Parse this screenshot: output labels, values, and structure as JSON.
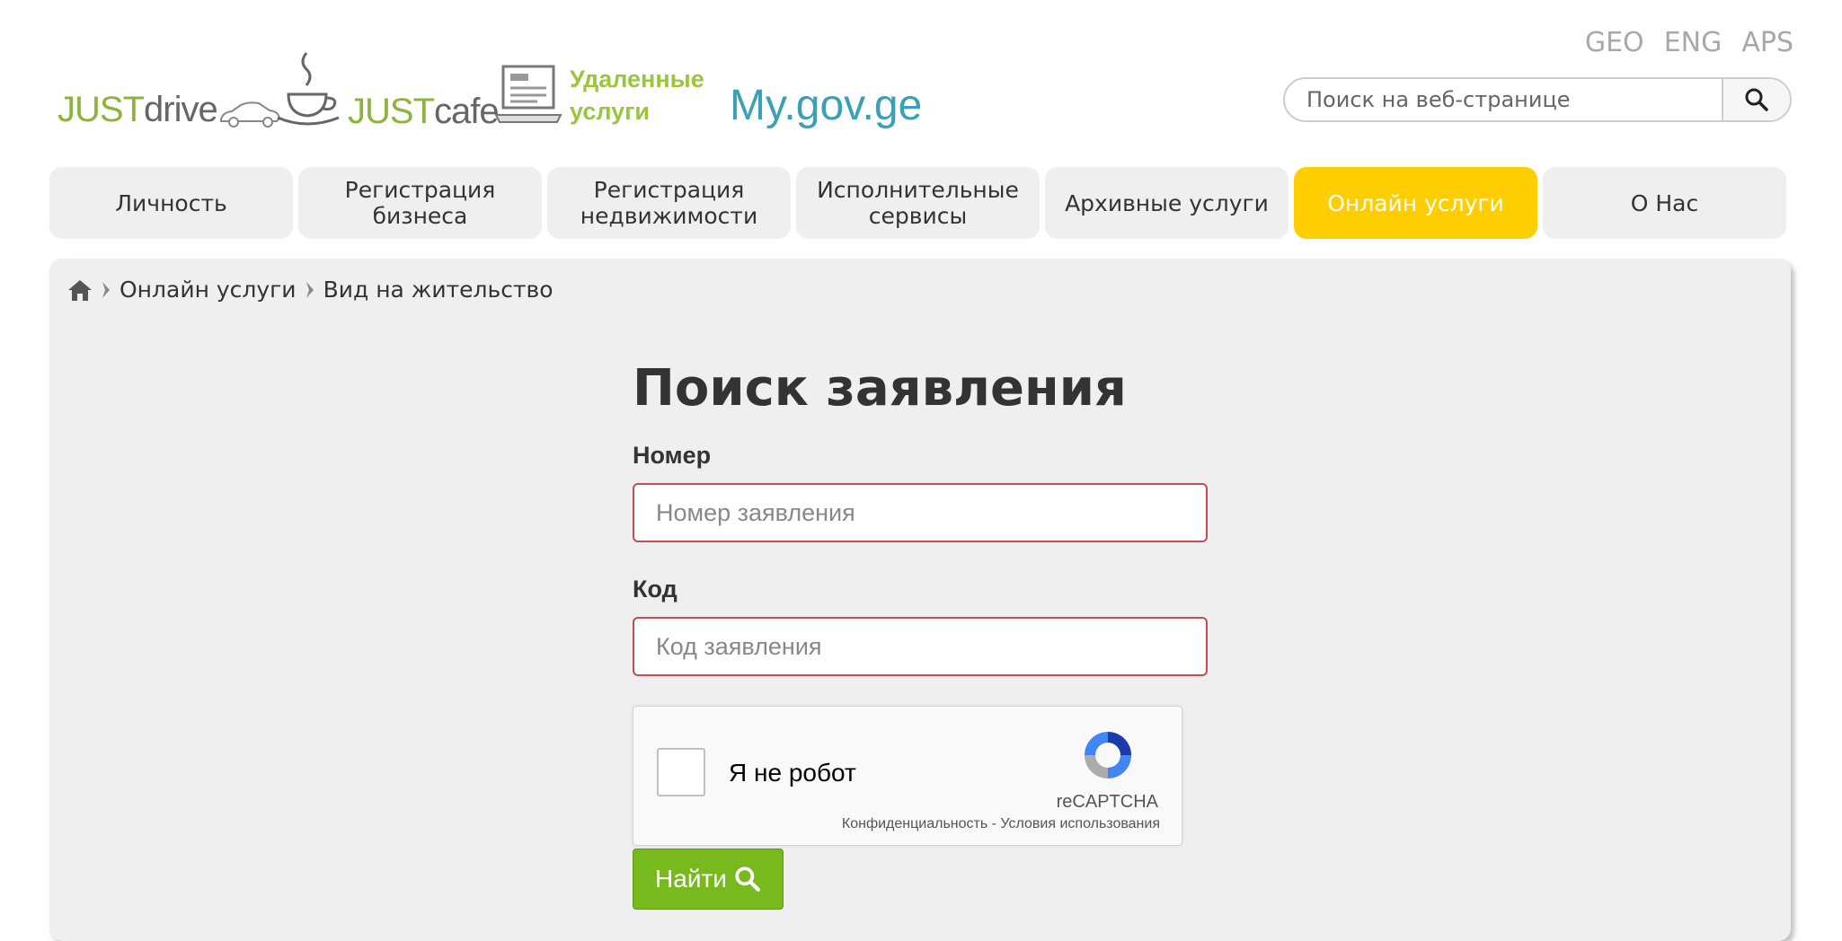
{
  "languages": [
    "GEO",
    "ENG",
    "APS"
  ],
  "logos": {
    "justdrive": {
      "just": "JUST",
      "rest": "drive"
    },
    "justcafe": {
      "just": "JUST",
      "rest": "cafe"
    },
    "remote": {
      "line1": "Удаленные",
      "line2": "услуги"
    },
    "mygov": "My.gov.ge"
  },
  "search": {
    "placeholder": "Поиск на веб-странице"
  },
  "nav": [
    {
      "label": "Личность"
    },
    {
      "label": "Регистрация\nбизнеса"
    },
    {
      "label": "Регистрация\nнедвижимости"
    },
    {
      "label": "Исполнительные\nсервисы"
    },
    {
      "label": "Архивные услуги"
    },
    {
      "label": "Онлайн услуги",
      "active": true
    },
    {
      "label": "О Нас"
    }
  ],
  "breadcrumb": {
    "items": [
      "Онлайн услуги",
      "Вид на жительство"
    ]
  },
  "form": {
    "title": "Поиск заявления",
    "number_label": "Номер",
    "number_placeholder": "Номер заявления",
    "code_label": "Код",
    "code_placeholder": "Код заявления",
    "submit_label": "Найти"
  },
  "captcha": {
    "label": "Я не робот",
    "brand": "reCAPTCHA",
    "privacy": "Конфиденциальность",
    "separator": " - ",
    "terms": "Условия использования"
  },
  "colors": {
    "active_nav": "#ffce00",
    "submit": "#78b91e",
    "field_border": "#c84a55",
    "accent_green": "#8cb43c",
    "mygov": "#3aa0b5"
  }
}
